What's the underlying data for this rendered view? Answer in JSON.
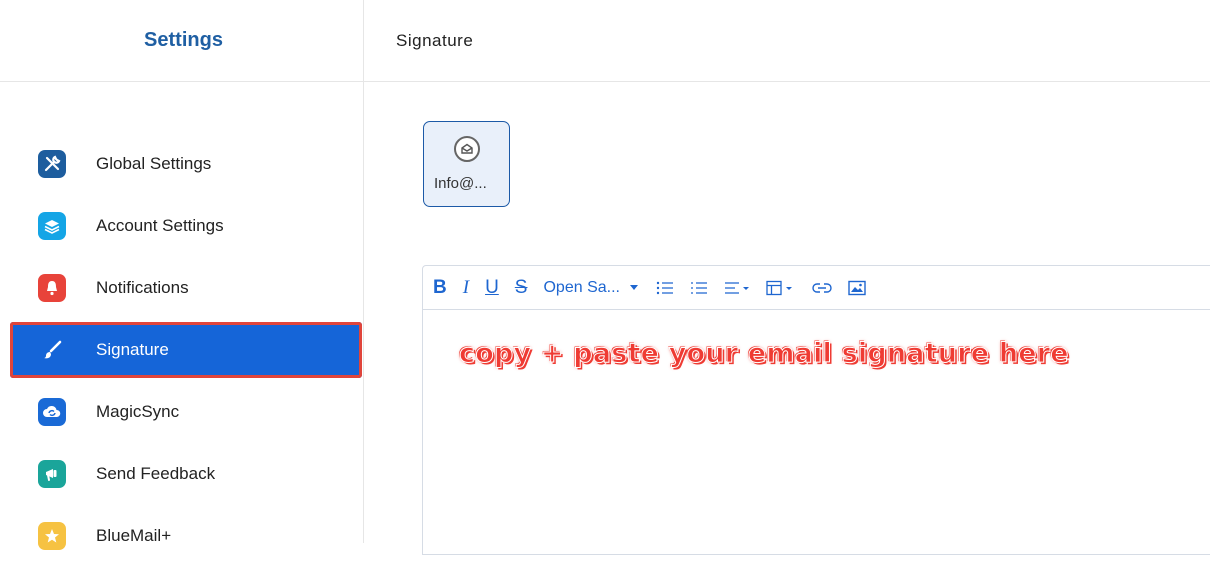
{
  "sidebar": {
    "title": "Settings",
    "items": [
      {
        "label": "Global Settings",
        "icon": "tools-icon",
        "color": "#1d5d9e"
      },
      {
        "label": "Account Settings",
        "icon": "layers-icon",
        "color": "#14a5e6"
      },
      {
        "label": "Notifications",
        "icon": "bell-icon",
        "color": "#e8433a"
      },
      {
        "label": "Signature",
        "icon": "brush-icon",
        "color": "#1565d8",
        "active": true
      },
      {
        "label": "MagicSync",
        "icon": "sync-cloud-icon",
        "color": "#1a6ad6"
      },
      {
        "label": "Send Feedback",
        "icon": "megaphone-icon",
        "color": "#1aa59a"
      },
      {
        "label": "BlueMail+",
        "icon": "star-icon",
        "color": "#f6c242"
      }
    ]
  },
  "main": {
    "title": "Signature",
    "account": {
      "label": "Info@..."
    },
    "toolbar": {
      "font": "Open Sa...",
      "buttons": [
        "B",
        "I",
        "U",
        "S"
      ]
    },
    "annotation": "copy + paste your email signature here"
  },
  "colors": {
    "accent": "#1565d8",
    "highlight_border": "#e0453b",
    "annotation": "#ef3b33"
  }
}
